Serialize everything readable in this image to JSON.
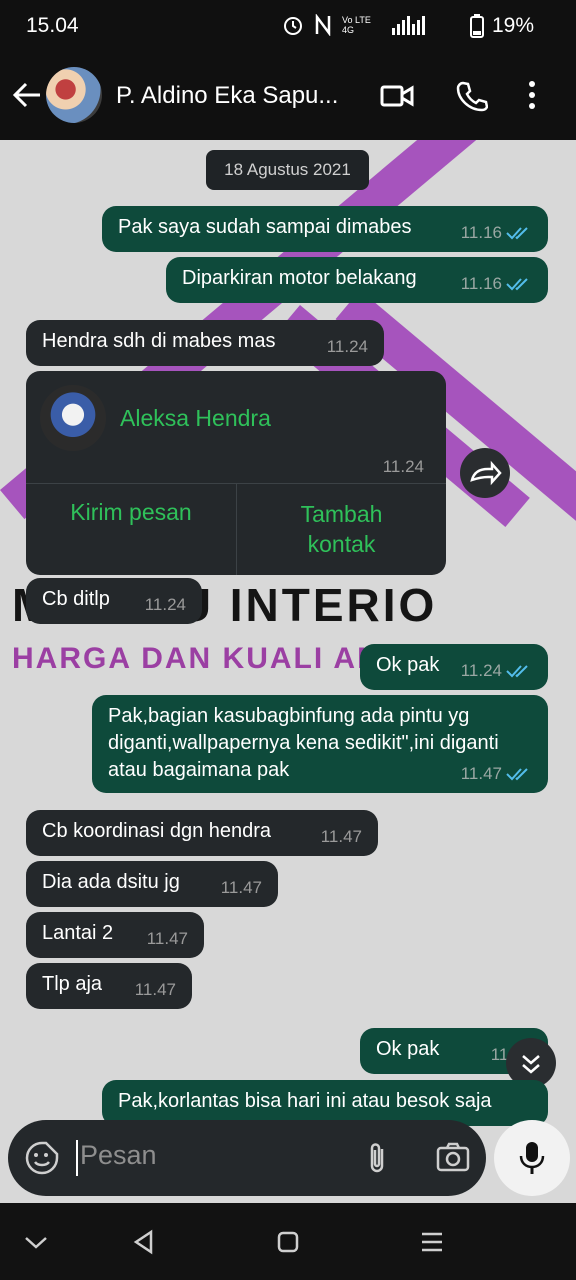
{
  "status_bar": {
    "time": "15.04",
    "network": "Vo LTE 4G",
    "battery": "19%"
  },
  "header": {
    "contact_name": "P. Aldino Eka Sapu..."
  },
  "date_chip": "18 Agustus 2021",
  "messages": [
    {
      "dir": "out",
      "text": "Pak saya sudah sampai dimabes",
      "time": "11.16"
    },
    {
      "dir": "out",
      "text": "Diparkiran motor belakang",
      "time": "11.16"
    },
    {
      "dir": "in",
      "text": "Hendra sdh di mabes mas",
      "time": "11.24"
    },
    {
      "dir": "in",
      "text": "Cb ditlp",
      "time": "11.24"
    },
    {
      "dir": "out",
      "text": "Ok pak",
      "time": "11.24"
    },
    {
      "dir": "out",
      "text": "Pak,bagian kasubagbinfung ada pintu yg diganti,wallpapernya kena sedikit\",ini diganti atau bagaimana pak",
      "time": "11.47"
    },
    {
      "dir": "in",
      "text": "Cb koordinasi dgn hendra",
      "time": "11.47"
    },
    {
      "dir": "in",
      "text": "Dia ada dsitu jg",
      "time": "11.47"
    },
    {
      "dir": "in",
      "text": "Lantai 2",
      "time": "11.47"
    },
    {
      "dir": "in",
      "text": "Tlp aja",
      "time": "11.47"
    },
    {
      "dir": "out",
      "text": "Ok pak",
      "time": "11.47"
    },
    {
      "dir": "out",
      "text": "Pak,korlantas bisa hari ini atau besok saja",
      "time": ""
    }
  ],
  "contact_card": {
    "name": "Aleksa Hendra",
    "time": "11.24",
    "send_message": "Kirim pesan",
    "add_contact": "Tambah kontak"
  },
  "watermark": {
    "line1": "M BARU INTERIO",
    "line2": "HARGA DAN KUALI AN"
  },
  "composer": {
    "placeholder": "Pesan"
  },
  "colors": {
    "outgoing": "#0e4a3b",
    "incoming": "#24282b",
    "accent_green": "#2fc15a",
    "read_ticks": "#53bdeb"
  }
}
